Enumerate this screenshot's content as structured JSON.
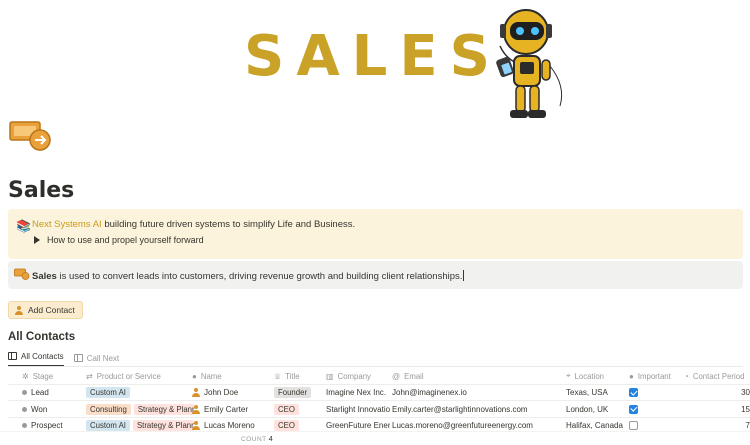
{
  "banner": {
    "title": "SALES",
    "accent": "#c9a227"
  },
  "page": {
    "title": "Sales",
    "icon": "money-transfer-icon"
  },
  "callout_yellow": {
    "icon": "books-icon",
    "link_text": "Next Systems AI",
    "text": " building future driven systems to simplify Life and Business.",
    "toggle_label": "How to use and propel yourself forward"
  },
  "callout_gray": {
    "icon": "money-transfer-icon",
    "bold": "Sales",
    "text": " is used to convert leads into customers, driving revenue growth and building client relationships."
  },
  "add_contact": {
    "label": "Add Contact"
  },
  "database": {
    "title": "All Contacts",
    "views": [
      {
        "label": "All Contacts",
        "active": true
      },
      {
        "label": "Call Next",
        "active": false
      }
    ],
    "columns": {
      "stage": "Stage",
      "product": "Product or Service",
      "name": "Name",
      "title": "Title",
      "company": "Company",
      "email": "Email",
      "location": "Location",
      "important": "Important",
      "period": "Contact Period"
    },
    "rows": [
      {
        "stage": "Lead",
        "products": [
          "Custom AI"
        ],
        "name": "John Doe",
        "title": "Founder",
        "company": "Imagine Nex Inc.",
        "email": "John@imaginenex.io",
        "location": "Texas, USA",
        "important": true,
        "period": "30"
      },
      {
        "stage": "Won",
        "products": [
          "Consulting",
          "Strategy & Planning"
        ],
        "name": "Emily Carter",
        "title": "CEO",
        "company": "Starlight Innovations",
        "email": "Emily.carter@starlightinnovations.com",
        "location": "London, UK",
        "important": true,
        "period": "15"
      },
      {
        "stage": "Prospect",
        "products": [
          "Custom AI",
          "Strategy & Planning"
        ],
        "name": "Lucas Moreno",
        "title": "CEO",
        "company": "GreenFuture Energy",
        "email": "Lucas.moreno@greenfutureenergy.com",
        "location": "Halifax, Canada",
        "important": false,
        "period": "7"
      }
    ],
    "count_label": "COUNT",
    "count": "4"
  }
}
